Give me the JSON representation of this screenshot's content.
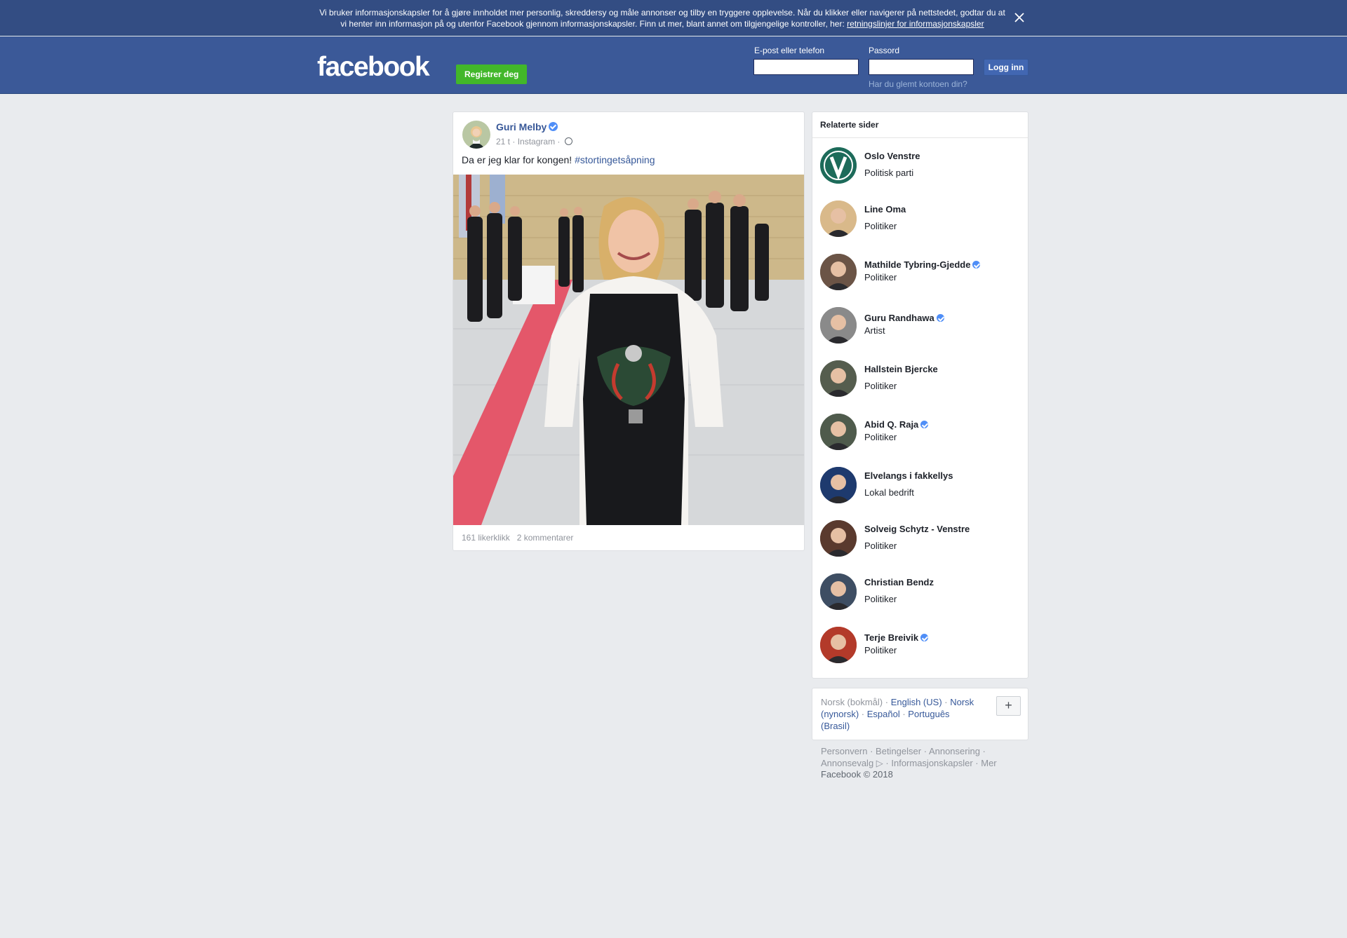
{
  "cookie_banner": {
    "text": "Vi bruker informasjonskapsler for å gjøre innholdet mer personlig, skreddersy og måle annonser og tilby en tryggere opplevelse. Når du klikker eller navigerer på nettstedet, godtar du at vi henter inn informasjon på og utenfor Facebook gjennom informasjonskapsler. Finn ut mer, blant annet om tilgjengelige kontroller, her: ",
    "link": "retningslinjer for informasjonskapsler",
    "close_icon": "close-icon"
  },
  "header": {
    "logo": "facebook",
    "register_label": "Registrer deg",
    "email_label": "E-post eller telefon",
    "email_value": "",
    "password_label": "Passord",
    "password_value": "",
    "login_label": "Logg inn",
    "forgot_label": "Har du glemt kontoen din?"
  },
  "post": {
    "author": "Guri Melby",
    "verified": true,
    "time": "21 t",
    "source": "Instagram",
    "separator": "·",
    "text": "Da er jeg klar for kongen! ",
    "hashtag": "#stortingetsåpning",
    "likes": "161 likerklikk",
    "comments": "2 kommentarer"
  },
  "related": {
    "title": "Relaterte sider",
    "items": [
      {
        "name": "Oslo Venstre",
        "category": "Politisk parti",
        "verified": false,
        "avatar_color": "#1d6b5a"
      },
      {
        "name": "Line Oma",
        "category": "Politiker",
        "verified": false,
        "avatar_color": "#d9b98a"
      },
      {
        "name": "Mathilde Tybring-Gjedde",
        "category": "Politiker",
        "verified": true,
        "avatar_color": "#6b5446"
      },
      {
        "name": "Guru Randhawa",
        "category": "Artist",
        "verified": true,
        "avatar_color": "#8a8a8a"
      },
      {
        "name": "Hallstein Bjercke",
        "category": "Politiker",
        "verified": false,
        "avatar_color": "#555d4e"
      },
      {
        "name": "Abid Q. Raja",
        "category": "Politiker",
        "verified": true,
        "avatar_color": "#4f5b4c"
      },
      {
        "name": "Elvelangs i fakkellys",
        "category": "Lokal bedrift",
        "verified": false,
        "avatar_color": "#1e3a6e"
      },
      {
        "name": "Solveig Schytz - Venstre",
        "category": "Politiker",
        "verified": false,
        "avatar_color": "#5a3a2e"
      },
      {
        "name": "Christian Bendz",
        "category": "Politiker",
        "verified": false,
        "avatar_color": "#3e4e63"
      },
      {
        "name": "Terje Breivik",
        "category": "Politiker",
        "verified": true,
        "avatar_color": "#b33a2a"
      }
    ]
  },
  "languages": {
    "current": "Norsk (bokmål)",
    "options": [
      "English (US)",
      "Norsk (nynorsk)",
      "Español",
      "Português (Brasil)"
    ],
    "plus": "+"
  },
  "footer": {
    "links": [
      "Personvern",
      "Betingelser",
      "Annonsering",
      "Annonsevalg",
      "Informasjonskapsler",
      "Mer"
    ],
    "copyright": "Facebook © 2018"
  },
  "colors": {
    "brand": "#3b5998",
    "register": "#42b72a",
    "link": "#365899",
    "verified": "#4f8ef7"
  }
}
